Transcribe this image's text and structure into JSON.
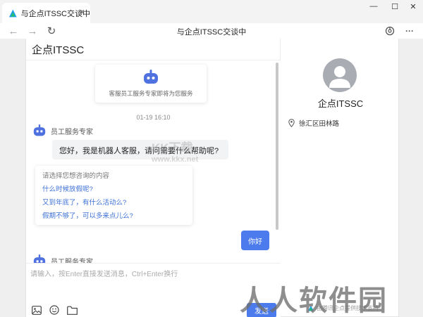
{
  "browser": {
    "tab_title": "与企点ITSSC交谈中",
    "page_title": "与企点ITSSC交谈中",
    "tab_close": "×",
    "win_minimize": "—",
    "win_maximize": "☐",
    "win_close": "✕",
    "nav_back": "←",
    "nav_forward": "→",
    "nav_reload": "↻",
    "menu_more": "···"
  },
  "chat": {
    "header_title": "企点ITSSC",
    "system_notice": "客服员工服务专家即将为您服务",
    "timestamp": "01-19 16:10",
    "agent_name": "员工服务专家",
    "agent_name_2": "员工服务专家",
    "greeting": "您好，我是机器人客服，请问需要什么帮助呢?",
    "faq": {
      "title": "请选择您想咨询的内容",
      "items": [
        "什么时候放假呢?",
        "又到年底了，有什么活动么?",
        "假期不够了，可以多来点儿么?"
      ]
    },
    "user_message": "你好"
  },
  "input": {
    "placeholder": "请输入，按Enter直接发送消息，Ctrl+Enter换行",
    "send_label": "发送"
  },
  "profile": {
    "name": "企点ITSSC",
    "location": "徐汇区田林路"
  },
  "footer": {
    "powered_by": "由腾讯企点提供技术支持"
  },
  "watermarks": {
    "site_cn": "KK下载",
    "site_url": "www.kkx.net",
    "brand": "人人软件园"
  },
  "colors": {
    "accent": "#4b7bec",
    "link": "#3f72d6",
    "bot": "#4f72e0"
  }
}
